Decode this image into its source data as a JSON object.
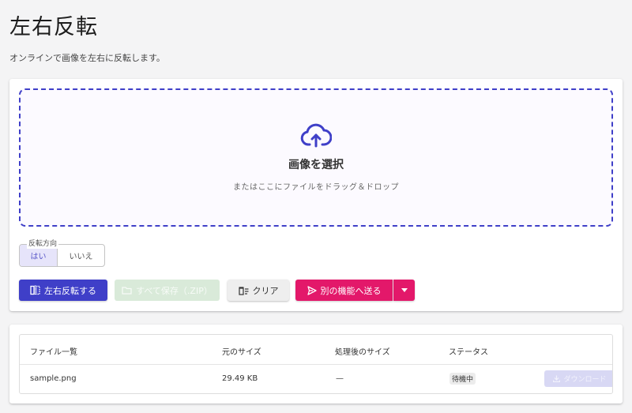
{
  "header": {
    "title": "左右反転",
    "description": "オンラインで画像を左右に反転します。"
  },
  "dropzone": {
    "icon": "cloud-upload-icon",
    "title": "画像を選択",
    "subtitle": "またはここにファイルをドラッグ＆ドロップ"
  },
  "direction": {
    "legend": "反転方向",
    "options": [
      "はい",
      "いいえ"
    ],
    "selected": "はい"
  },
  "actions": {
    "flip_label": "左右反転する",
    "save_all_label": "すべて保存（.ZIP）",
    "clear_label": "クリア",
    "send_label": "別の機能へ送る"
  },
  "colors": {
    "primary": "#3f3fc8",
    "accent": "#e3186a",
    "success_disabled": "#d9ead9"
  },
  "table": {
    "headers": [
      "ファイル一覧",
      "元のサイズ",
      "処理後のサイズ",
      "ステータス"
    ],
    "rows": [
      {
        "file": "sample.png",
        "original_size": "29.49 KB",
        "processed_size": "—",
        "status": "待機中",
        "download_label": "ダウンロード"
      }
    ]
  }
}
